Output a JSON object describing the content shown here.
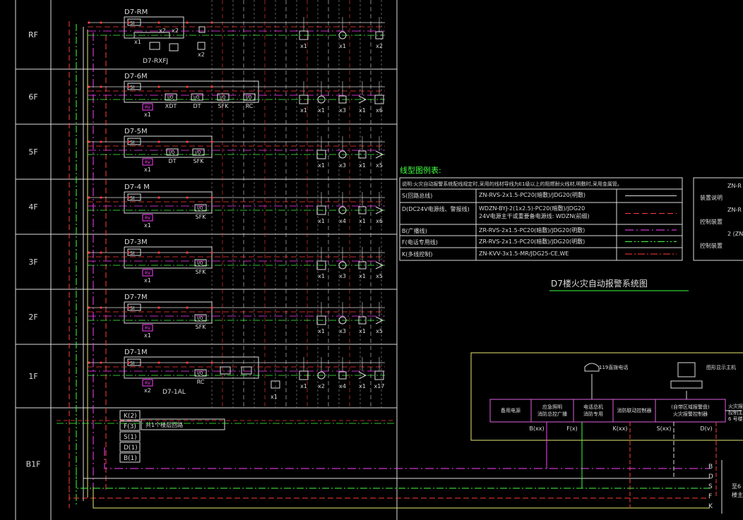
{
  "floors": [
    "RF",
    "6F",
    "5F",
    "4F",
    "3F",
    "2F",
    "1F",
    "B1F"
  ],
  "panels": [
    {
      "title": "D7-RM",
      "tags": [
        "x1",
        "x2",
        "x2"
      ],
      "devices": []
    },
    {
      "title": "D7-6M",
      "tags": [
        "x1"
      ],
      "devices": [
        "XDT",
        "DT",
        "SFK",
        "RC"
      ]
    },
    {
      "title": "D7-5M",
      "tags": [
        "x1"
      ],
      "devices": [
        "DT",
        "SFK"
      ]
    },
    {
      "title": "D7-4 M",
      "tags": [
        "x1"
      ],
      "devices": [
        "SFK"
      ]
    },
    {
      "title": "D7-3M",
      "tags": [
        "x1"
      ],
      "devices": [
        "SFK"
      ]
    },
    {
      "title": "D7-7M",
      "tags": [
        "x1"
      ],
      "devices": [
        "SFK"
      ]
    },
    {
      "title": "D7-1M",
      "tags": [
        "x2"
      ],
      "devices": [
        "RC"
      ]
    }
  ],
  "extra_labels": {
    "rf_box": "D7-RXFJ",
    "rf_x2": "x2",
    "f1_box": "D7-1AL",
    "device_tag_x1": "x1"
  },
  "column_counts": {
    "RF": [
      "x1",
      "x1",
      "x2"
    ],
    "6F": [
      "x1",
      "x1",
      "x3",
      "x1",
      "x6"
    ],
    "5F": [
      "x1",
      "x3",
      "x1",
      "x5"
    ],
    "4F": [
      "x1",
      "x4",
      "x1",
      "x6"
    ],
    "3F": [
      "x1",
      "x3",
      "x1",
      "x5"
    ],
    "2F": [
      "x1",
      "x3",
      "x1",
      "x5"
    ],
    "1F": [
      "x1",
      "x2",
      "x4",
      "x1",
      "x17"
    ]
  },
  "bus_labels": [
    "K(2)",
    "F(3)",
    "S(1)",
    "D(1)",
    "B(1)"
  ],
  "bus_note": "共1个楼层回路",
  "legend": {
    "title": "线型图例表:",
    "note": "说明:火灾自动报警系统配线规定时,采用的线材导线为E1级以上的阻燃耐火线材,明敷时,采用金属管。",
    "rows": [
      {
        "name": "S(回路总线)",
        "spec": "ZN-RVS-2x1.5-PC20(暗敷)/JDG20(明敷)",
        "color": "#dcdcdc",
        "dash": ""
      },
      {
        "name": "D(DC24V电源线、警报线)",
        "spec": "WDZN-BYJ-2(1x2.5)-PC20(暗敷)/JDG20\n24V电源主干或重要备电源线:        WDZN(前缀)",
        "color": "#ff3c3c",
        "dash": "8 4"
      },
      {
        "name": "B(广播线)",
        "spec": "ZR-RVS-2x1.5-PC20(暗敷)/JDG20(明敷)",
        "color": "#ff40ff",
        "dash": "12 4 2 4"
      },
      {
        "name": "F(电话专用线)",
        "spec": "ZR-RVS-2x1.5-PC20(暗敷)/JDG20(明敷)",
        "color": "#40ff40",
        "dash": "10 3 2 3 2 3"
      },
      {
        "name": "K(多线控制)",
        "spec": "ZN-KVV-3x1.5-MR/JDG25-CE,WE",
        "color": "#ff3c3c",
        "dash": "10 3 2 3"
      }
    ]
  },
  "right_box": [
    "ZN-R",
    "装置说明",
    "ZN-R",
    "控制装置",
    "2 (ZN-",
    "控制装置"
  ],
  "system_title": "D7楼火灾自动报警系统图",
  "control_center": {
    "phone_label": "119直拨电话",
    "graphic_label": "图形显示主机",
    "modules": [
      "备用电源",
      "应急照明\n消防总控广播",
      "电话总机\n消防专用",
      "消防联动控制器",
      "(自带区域报警盘)\n火灾报警控制器"
    ],
    "outputs": [
      "B(xx)",
      "F(x)",
      "K(xx)",
      "S(xx)",
      "D(v)"
    ],
    "side_text": [
      "火灾报",
      "控制主",
      "6 号楼"
    ]
  },
  "bottom_bus": [
    "B",
    "D",
    "S",
    "F",
    "K"
  ],
  "bottom_note": [
    "至6",
    "楼主"
  ]
}
